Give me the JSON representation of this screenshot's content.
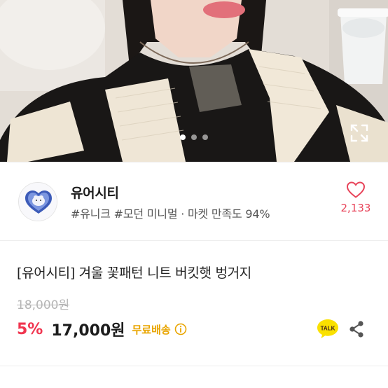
{
  "hero": {
    "image_alt": "Model wearing black and cream striped knit sweater",
    "page_dots": 3,
    "active_dot": 0,
    "expand_icon": "expand-icon"
  },
  "shop": {
    "name": "유어시티",
    "tags": "#유니크 #모던 미니멀 · 마켓 만족도 94%",
    "likes": "2,133",
    "like_icon": "heart-outline-icon",
    "accent": "#e8445a"
  },
  "product": {
    "title": "[유어시티] 겨울 꽃패턴 니트 버킷햇 벙거지",
    "original_price": "18,000원",
    "discount": "5%",
    "price": "17,000원",
    "shipping": "무료배송",
    "shipping_info_icon": "info-icon",
    "talk_label": "TALK",
    "share_icon": "share-icon",
    "colors": {
      "discount": "#f0354f",
      "shipping": "#e9a500",
      "talk": "#fae100"
    }
  }
}
